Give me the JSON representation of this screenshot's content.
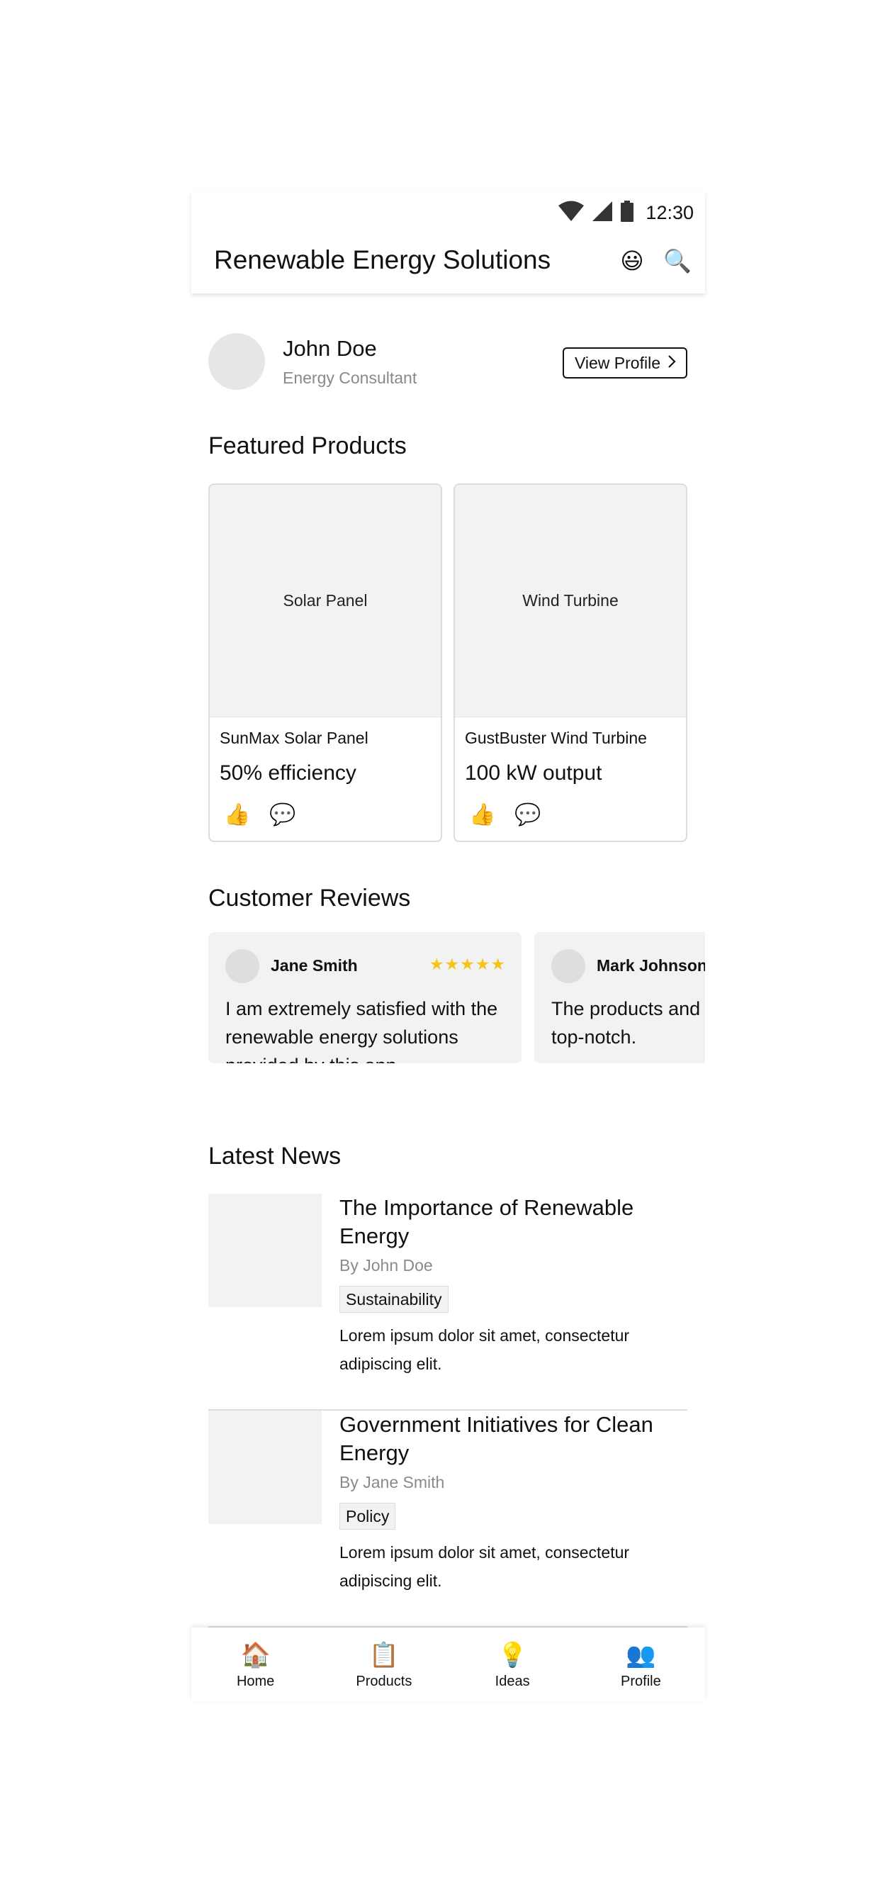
{
  "status_bar": {
    "time": "12:30"
  },
  "header": {
    "title": "Renewable Energy Solutions",
    "emoji_icon": "😃",
    "search_icon": "🔍"
  },
  "profile": {
    "name": "John Doe",
    "role": "Energy Consultant",
    "button_label": "View Profile"
  },
  "featured": {
    "title": "Featured Products",
    "products": [
      {
        "image_label": "Solar Panel",
        "name": "SunMax Solar Panel",
        "spec": "50% efficiency",
        "like_icon": "👍",
        "comment_icon": "💬"
      },
      {
        "image_label": "Wind Turbine",
        "name": "GustBuster Wind Turbine",
        "spec": "100 kW output",
        "like_icon": "👍",
        "comment_icon": "💬"
      }
    ]
  },
  "reviews": {
    "title": "Customer Reviews",
    "items": [
      {
        "name": "Jane Smith",
        "stars": "★★★★★",
        "rating": 5,
        "text": "I am extremely satisfied with the renewable energy solutions provided by this app."
      },
      {
        "name": "Mark Johnson",
        "text": "The products and services offered here are top-notch."
      }
    ]
  },
  "news": {
    "title": "Latest News",
    "items": [
      {
        "title": "The Importance of Renewable Energy",
        "author": "By John Doe",
        "tag": "Sustainability",
        "body": "Lorem ipsum dolor sit amet, consectetur adipiscing elit."
      },
      {
        "title": "Government Initiatives for Clean Energy",
        "author": "By Jane Smith",
        "tag": "Policy",
        "body": "Lorem ipsum dolor sit amet, consectetur adipiscing elit."
      }
    ]
  },
  "bottom_nav": [
    {
      "icon": "🏠",
      "label": "Home"
    },
    {
      "icon": "📋",
      "label": "Products"
    },
    {
      "icon": "💡",
      "label": "Ideas"
    },
    {
      "icon": "👥",
      "label": "Profile"
    }
  ],
  "colors": {
    "star": "#f6c419",
    "card_bg": "#f2f2f2",
    "muted_text": "#8a8a8a",
    "border": "#dcdcdc"
  }
}
